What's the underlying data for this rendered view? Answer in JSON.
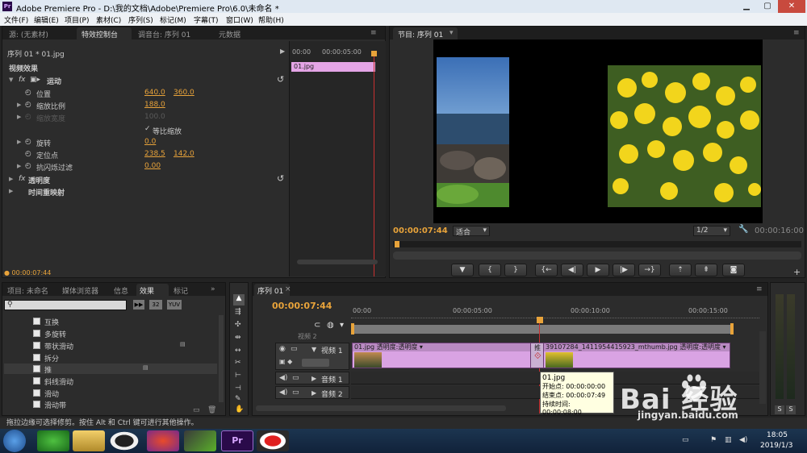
{
  "window": {
    "title": "Adobe Premiere Pro - D:\\我的文档\\Adobe\\Premiere Pro\\6.0\\未命名 *",
    "logo": "Pr"
  },
  "menu": [
    "文件(F)",
    "编辑(E)",
    "项目(P)",
    "素材(C)",
    "序列(S)",
    "标记(M)",
    "字幕(T)",
    "窗口(W)",
    "帮助(H)"
  ],
  "source_panel": {
    "tabs": [
      "源: (无素材)",
      "特效控制台",
      "调音台: 序列 01",
      "元数据"
    ],
    "header": "序列 01 * 01.jpg",
    "timecode_start": "00:00",
    "timecode_mid": "00:00:05:00",
    "clip_label": "01.jpg",
    "section": "视频效果",
    "motion": "运动",
    "position": {
      "label": "位置",
      "x": "640.0",
      "y": "360.0"
    },
    "scale": {
      "label": "缩放比例",
      "v": "188.0"
    },
    "scale_width": {
      "label": "缩放宽度",
      "v": "100.0"
    },
    "uniform": "等比缩放",
    "rotation": {
      "label": "旋转",
      "v": "0.0"
    },
    "anchor": {
      "label": "定位点",
      "x": "238.5",
      "y": "142.0"
    },
    "flicker": {
      "label": "抗闪烁过滤",
      "v": "0.00"
    },
    "opacity": "透明度",
    "timeremap": "时间重映射",
    "current_time": "00:00:07:44"
  },
  "program": {
    "tab": "节目: 序列 01",
    "timecode": "00:00:07:44",
    "fit": "适合",
    "quality": "1/2",
    "duration": "00:00:16:00",
    "buttons": [
      "mark",
      "in",
      "out",
      "goto-in",
      "step-back",
      "play",
      "step-fwd",
      "goto-out",
      "lift",
      "extract",
      "export-frame"
    ]
  },
  "project": {
    "tabs": [
      "项目: 未命名",
      "媒体浏览器",
      "信息",
      "效果",
      "标记"
    ],
    "badges": [
      "32",
      "YUV"
    ],
    "effects": [
      "互换",
      "多旋转",
      "带状滑动",
      "拆分",
      "推",
      "斜线滑动",
      "滑动",
      "滑动带"
    ]
  },
  "timeline": {
    "tab": "序列 01",
    "timecode": "00:00:07:44",
    "ruler": [
      "00:00",
      "00:00:05:00",
      "00:00:10:00",
      "00:00:15:00"
    ],
    "video1": "视频 1",
    "audio1": "音频 1",
    "audio2": "音频 2",
    "video2_partial": "视频 2",
    "clip1": "01.jpg 透明度:透明度 ▾",
    "clip2": "39107284_1411954415923_mthumb.jpg 透明度:透明度 ▾",
    "transition": "推",
    "tooltip": [
      "01.jpg",
      "开始点: 00:00:00:00",
      "结束点: 00:00:07:49",
      "持续时间: 00:00:08:00"
    ]
  },
  "status": "拖拉边缘可选择修剪。按住 Alt 和 Ctrl 键可进行其他操作。",
  "meter": {
    "s1": "S",
    "s2": "S"
  },
  "taskbar": {
    "time": "18:05",
    "date": "2019/1/3"
  },
  "watermark": {
    "brand": "Bai  经验",
    "url": "jingyan.baidu.com"
  },
  "colors": {
    "timecode": "#e8a33a",
    "clip": "#d9a3e3",
    "playhead": "#c83030"
  }
}
